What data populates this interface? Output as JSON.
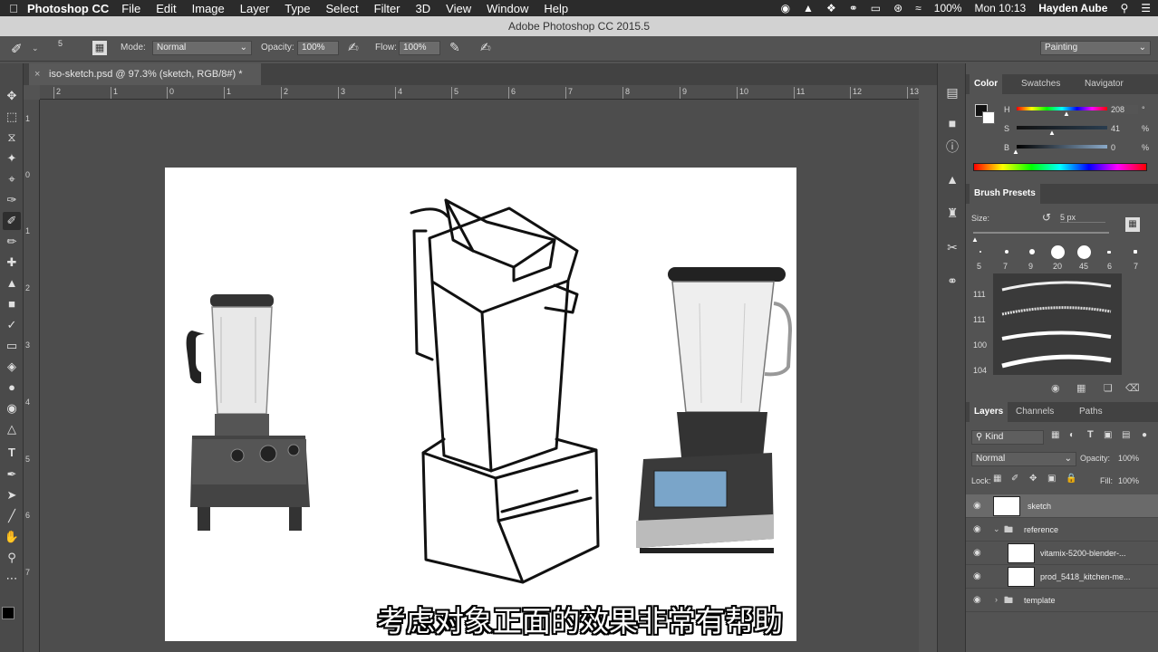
{
  "menubar": {
    "app": "Photoshop CC",
    "items": [
      "File",
      "Edit",
      "Image",
      "Layer",
      "Type",
      "Select",
      "Filter",
      "3D",
      "View",
      "Window",
      "Help"
    ],
    "battery": "100%",
    "clock": "Mon 10:13",
    "user": "Hayden Aube"
  },
  "window_title": "Adobe Photoshop CC 2015.5",
  "options": {
    "brush_size": "5",
    "mode_label": "Mode:",
    "mode_value": "Normal",
    "opacity_label": "Opacity:",
    "opacity_value": "100%",
    "flow_label": "Flow:",
    "flow_value": "100%",
    "workspace": "Painting"
  },
  "document": {
    "tab_title": "iso-sketch.psd @ 97.3% (sketch, RGB/8#) *"
  },
  "rulers": {
    "h_ticks": [
      "2",
      "1",
      "0",
      "1",
      "2",
      "3",
      "4",
      "5",
      "6",
      "7",
      "8",
      "9",
      "10",
      "11",
      "12",
      "13"
    ],
    "v_ticks": [
      "1",
      "0",
      "1",
      "2",
      "3",
      "4",
      "5",
      "6",
      "7"
    ]
  },
  "subtitle": "考虑对象正面的效果非常有帮助",
  "color_panel": {
    "tabs": [
      "Color",
      "Swatches",
      "Navigator"
    ],
    "h_label": "H",
    "h_value": "208",
    "h_unit": "°",
    "s_label": "S",
    "s_value": "41",
    "s_unit": "%",
    "b_label": "B",
    "b_value": "0",
    "b_unit": "%"
  },
  "brush_presets": {
    "title": "Brush Presets",
    "size_label": "Size:",
    "size_value": "5 px",
    "tips": [
      "5",
      "7",
      "9",
      "20",
      "45",
      "6",
      "7"
    ],
    "strokes": [
      "111",
      "111",
      "100",
      "104"
    ]
  },
  "layers_panel": {
    "tabs": [
      "Layers",
      "Channels",
      "Paths"
    ],
    "kind": "Kind",
    "blend": "Normal",
    "opacity_label": "Opacity:",
    "opacity_value": "100%",
    "lock_label": "Lock:",
    "fill_label": "Fill:",
    "fill_value": "100%",
    "layers": [
      {
        "name": "sketch"
      },
      {
        "name": "reference"
      },
      {
        "name": "vitamix-5200-blender-..."
      },
      {
        "name": "prod_5418_kitchen-me..."
      },
      {
        "name": "template"
      }
    ]
  }
}
